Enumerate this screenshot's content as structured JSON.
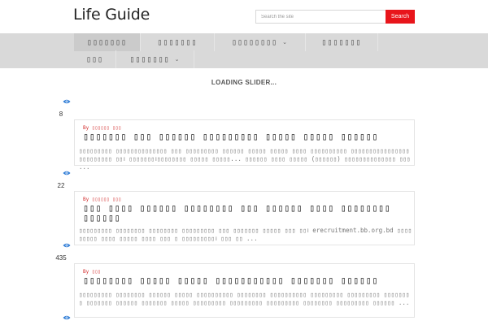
{
  "header": {
    "site_title": "Life Guide",
    "search_placeholder": "Search the site",
    "search_button": "Search"
  },
  "nav": {
    "items": [
      {
        "label": "▯▯▯▯▯▯▯",
        "active": true,
        "dropdown": false
      },
      {
        "label": "▯▯▯▯▯▯▯",
        "active": false,
        "dropdown": false
      },
      {
        "label": "▯▯▯▯▯▯▯▯",
        "active": false,
        "dropdown": true
      },
      {
        "label": "▯▯▯▯▯▯▯",
        "active": false,
        "dropdown": false
      },
      {
        "label": "▯▯▯",
        "active": false,
        "dropdown": false
      },
      {
        "label": "▯▯▯▯▯▯▯",
        "active": false,
        "dropdown": true
      }
    ]
  },
  "loading_text": "LOADING SLIDER...",
  "posts": [
    {
      "views": "8",
      "category": "By ▯▯▯▯▯▯ ▯▯▯",
      "title": "▯▯▯▯▯▯▯ ▯▯▯ ▯▯▯▯▯▯ ▯▯▯▯▯▯▯▯▯ ▯▯▯▯▯ ▯▯▯▯▯ ▯▯▯▯▯▯",
      "excerpt": "▯▯▯▯▯▯▯▯▯ ▯▯▯▯▯▯▯▯▯▯▯▯▯▯ ▯▯▯ ▯▯▯▯▯▯▯▯▯ ▯▯▯▯▯▯ ▯▯▯▯▯ ▯▯▯▯▯ ▯▯▯▯ ▯▯▯▯▯▯▯▯▯▯ ▯▯▯▯▯▯▯▯▯▯▯▯▯▯▯▯ ▯▯▯▯▯▯▯▯▯ ▯▯। ▯▯▯▯▯▯▯।▯▯▯▯▯▯▯▯ ▯▯▯▯▯ ▯▯▯▯▯... ▯▯▯▯▯▯ ▯▯▯▯ ▯▯▯▯▯ (▯▯▯▯▯▯) ▯▯▯▯▯▯▯▯▯▯▯▯▯▯ ▯▯▯ ..."
    },
    {
      "views": "22",
      "category": "By ▯▯▯▯▯▯ ▯▯▯",
      "title": "▯▯▯ ▯▯▯▯ ▯▯▯▯▯▯ ▯▯▯▯▯▯▯▯ ▯▯▯ ▯▯▯▯▯▯ ▯▯▯▯ ▯▯▯▯▯▯▯▯ ▯▯▯▯▯▯",
      "excerpt": "▯▯▯▯▯▯▯▯▯ ▯▯▯▯▯▯▯▯ ▯▯▯▯▯▯▯▯ ▯▯▯▯▯▯▯▯▯ ▯▯▯ ▯▯▯▯▯▯▯ ▯▯▯▯▯ ▯▯▯ ▯▯। erecruitment.bb.org.bd ▯▯▯▯▯▯▯▯▯ ▯▯▯▯ ▯▯▯▯▯ ▯▯▯▯ ▯▯▯ ▯ ▯▯▯▯▯▯▯▯▯। ▯▯▯ ▯▯ ..."
    },
    {
      "views": "435",
      "category": "By ▯▯▯",
      "title": "▯▯▯▯▯▯▯▯ ▯▯▯▯▯ ▯▯▯▯▯ ▯▯▯▯▯▯▯▯▯▯▯ ▯▯▯▯▯▯▯ ▯▯▯▯▯▯",
      "excerpt": "▯▯▯▯▯▯▯▯▯ ▯▯▯▯▯▯▯▯ ▯▯▯▯▯▯ ▯▯▯▯▯ ▯▯▯▯▯▯▯▯▯▯ ▯▯▯▯▯▯▯▯ ▯▯▯▯▯▯▯▯▯▯ ▯▯▯▯▯▯▯▯▯ ▯▯▯▯▯▯▯▯▯ ▯▯▯▯▯▯▯▯ ▯▯▯▯▯▯▯ ▯▯▯▯▯▯ ▯▯▯▯▯▯▯ ▯▯▯▯▯ ▯▯▯▯▯▯▯▯▯ ▯▯▯▯▯▯▯▯▯ ▯▯▯▯▯▯▯▯▯ ▯▯▯▯▯▯▯▯ ▯▯▯▯▯▯▯▯▯ ▯▯▯▯▯▯ ..."
    }
  ],
  "colors": {
    "accent": "#e8151b",
    "nav_bg": "#d9d9d9",
    "eye_icon": "#2d7bd6"
  }
}
